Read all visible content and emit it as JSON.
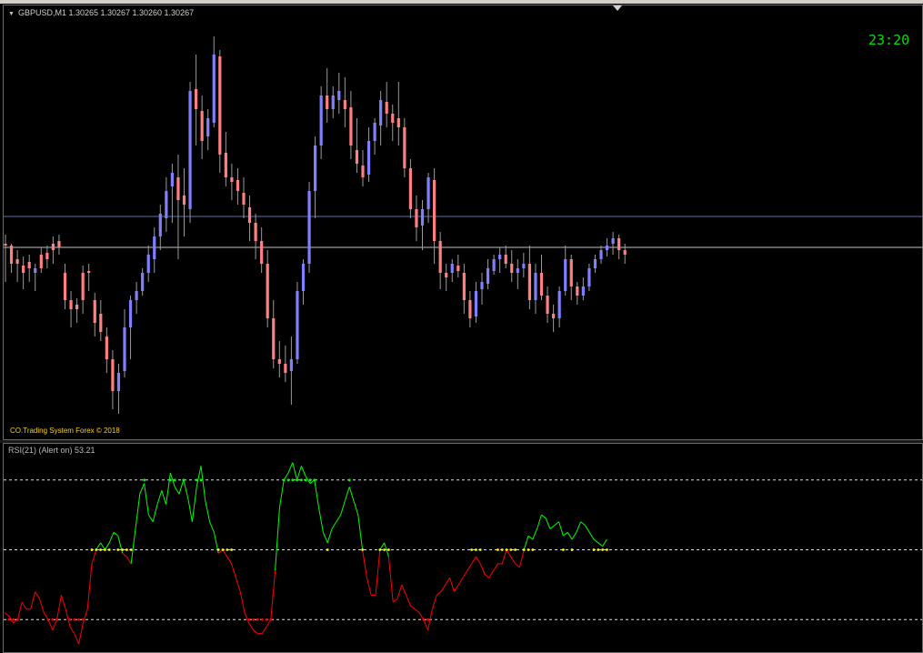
{
  "window": {
    "symbol_header": "GBPUSD,M1  1.30265 1.30267 1.30260 1.30267",
    "clock": "23:20",
    "copyright": "CO.Trading System Forex © 2018",
    "rsi_header": "RSI(21) (Alert on) 53.21"
  },
  "colors": {
    "bull_body": "#8080ff",
    "bear_body": "#ff8080",
    "wick": "#9a9a9a",
    "rsi_up": "#00ff00",
    "rsi_down": "#ff0000",
    "rsi_neutral_dots": "#ffff00",
    "bid_line": "#c0c0c0",
    "hline": "#5a6fa8"
  },
  "chart_data": [
    {
      "type": "candlestick",
      "price_to_y_ref": {
        "price_high_y": 40,
        "price_low_y": 455
      },
      "candles": [
        [
          268,
          258,
          310,
          268
        ],
        [
          270,
          268,
          300,
          290
        ],
        [
          285,
          275,
          310,
          290
        ],
        [
          292,
          282,
          318,
          300
        ],
        [
          288,
          280,
          310,
          295
        ],
        [
          300,
          290,
          320,
          295
        ],
        [
          280,
          272,
          300,
          295
        ],
        [
          278,
          270,
          295,
          285
        ],
        [
          268,
          260,
          290,
          275
        ],
        [
          265,
          258,
          280,
          272
        ],
        [
          300,
          290,
          340,
          330
        ],
        [
          330,
          320,
          360,
          340
        ],
        [
          335,
          328,
          355,
          340
        ],
        [
          300,
          292,
          345,
          330
        ],
        [
          298,
          290,
          320,
          300
        ],
        [
          330,
          322,
          370,
          355
        ],
        [
          345,
          330,
          375,
          365
        ],
        [
          370,
          360,
          410,
          395
        ],
        [
          395,
          385,
          450,
          430
        ],
        [
          430,
          400,
          455,
          410
        ],
        [
          408,
          340,
          415,
          360
        ],
        [
          360,
          325,
          395,
          330
        ],
        [
          330,
          310,
          345,
          320
        ],
        [
          320,
          295,
          325,
          300
        ],
        [
          300,
          270,
          310,
          280
        ],
        [
          285,
          250,
          300,
          260
        ],
        [
          260,
          225,
          275,
          235
        ],
        [
          240,
          195,
          255,
          210
        ],
        [
          205,
          180,
          245,
          190
        ],
        [
          195,
          170,
          285,
          220
        ],
        [
          215,
          185,
          260,
          225
        ],
        [
          230,
          90,
          245,
          100
        ],
        [
          98,
          60,
          160,
          120
        ],
        [
          122,
          105,
          175,
          155
        ],
        [
          150,
          120,
          165,
          130
        ],
        [
          135,
          40,
          140,
          60
        ],
        [
          62,
          55,
          190,
          170
        ],
        [
          168,
          145,
          205,
          195
        ],
        [
          195,
          180,
          220,
          200
        ],
        [
          198,
          185,
          225,
          210
        ],
        [
          212,
          195,
          240,
          225
        ],
        [
          228,
          215,
          265,
          245
        ],
        [
          245,
          235,
          285,
          265
        ],
        [
          265,
          250,
          300,
          290
        ],
        [
          290,
          275,
          360,
          350
        ],
        [
          350,
          330,
          405,
          395
        ],
        [
          395,
          375,
          415,
          400
        ],
        [
          400,
          380,
          420,
          410
        ],
        [
          408,
          370,
          445,
          395
        ],
        [
          395,
          310,
          400,
          320
        ],
        [
          320,
          285,
          335,
          290
        ],
        [
          290,
          200,
          300,
          210
        ],
        [
          210,
          150,
          240,
          160
        ],
        [
          160,
          95,
          175,
          105
        ],
        [
          105,
          75,
          135,
          120
        ],
        [
          120,
          95,
          130,
          105
        ],
        [
          110,
          80,
          125,
          100
        ],
        [
          110,
          85,
          140,
          120
        ],
        [
          118,
          100,
          175,
          160
        ],
        [
          165,
          130,
          190,
          180
        ],
        [
          182,
          165,
          205,
          195
        ],
        [
          192,
          140,
          200,
          155
        ],
        [
          155,
          130,
          170,
          135
        ],
        [
          138,
          100,
          160,
          110
        ],
        [
          112,
          90,
          140,
          125
        ],
        [
          125,
          115,
          155,
          135
        ],
        [
          130,
          90,
          160,
          140
        ],
        [
          140,
          130,
          195,
          185
        ],
        [
          185,
          175,
          240,
          230
        ],
        [
          230,
          215,
          265,
          250
        ],
        [
          248,
          220,
          275,
          230
        ],
        [
          230,
          190,
          245,
          195
        ],
        [
          198,
          185,
          290,
          265
        ],
        [
          265,
          255,
          318,
          300
        ],
        [
          300,
          290,
          320,
          305
        ],
        [
          300,
          285,
          310,
          290
        ],
        [
          292,
          280,
          305,
          298
        ],
        [
          300,
          290,
          345,
          330
        ],
        [
          330,
          320,
          360,
          350
        ],
        [
          348,
          310,
          355,
          320
        ],
        [
          318,
          300,
          335,
          310
        ],
        [
          312,
          285,
          318,
          295
        ],
        [
          298,
          280,
          302,
          285
        ],
        [
          285,
          272,
          300,
          280
        ],
        [
          280,
          270,
          295,
          290
        ],
        [
          290,
          275,
          310,
          300
        ],
        [
          300,
          285,
          318,
          295
        ],
        [
          295,
          278,
          305,
          290
        ],
        [
          290,
          270,
          340,
          330
        ],
        [
          330,
          290,
          345,
          300
        ],
        [
          300,
          280,
          330,
          325
        ],
        [
          325,
          315,
          355,
          345
        ],
        [
          345,
          335,
          365,
          350
        ],
        [
          350,
          315,
          360,
          320
        ],
        [
          320,
          270,
          325,
          285
        ],
        [
          285,
          280,
          330,
          315
        ],
        [
          315,
          310,
          335,
          325
        ],
        [
          325,
          305,
          330,
          315
        ],
        [
          315,
          290,
          320,
          295
        ],
        [
          295,
          280,
          300,
          285
        ],
        [
          285,
          270,
          290,
          275
        ],
        [
          275,
          262,
          282,
          270
        ],
        [
          268,
          255,
          280,
          262
        ],
        [
          262,
          258,
          285,
          275
        ],
        [
          275,
          268,
          290,
          280
        ]
      ]
    },
    {
      "type": "line",
      "title": "RSI(21) (Alert on) 53.21",
      "levels": [
        70,
        50,
        30
      ],
      "ylim": [
        22,
        78
      ],
      "values": [
        32,
        31,
        29,
        30,
        35,
        33,
        33,
        38,
        36,
        32,
        30,
        27,
        30,
        37,
        33,
        28,
        26,
        23,
        29,
        33,
        46,
        50,
        52,
        50,
        52,
        55,
        54,
        49,
        48,
        46,
        56,
        66,
        69,
        60,
        58,
        63,
        67,
        63,
        72,
        68,
        66,
        70,
        65,
        58,
        68,
        74,
        64,
        58,
        55,
        49,
        50,
        48,
        46,
        42,
        38,
        32,
        29,
        27,
        26,
        26,
        28,
        30,
        44,
        62,
        70,
        72,
        75,
        70,
        74,
        71,
        69,
        70,
        62,
        55,
        52,
        56,
        58,
        60,
        64,
        68,
        64,
        60,
        50,
        42,
        37,
        37,
        50,
        52,
        48,
        35,
        36,
        40,
        37,
        34,
        33,
        32,
        30,
        27,
        33,
        37,
        38,
        40,
        42,
        38,
        40,
        42,
        44,
        46,
        48,
        46,
        43,
        42,
        44,
        46,
        46,
        50,
        48,
        46,
        45,
        50,
        54,
        53,
        56,
        60,
        59,
        56,
        57,
        58,
        54,
        55,
        53,
        55,
        58,
        57,
        55,
        53,
        52,
        51,
        53
      ]
    }
  ]
}
